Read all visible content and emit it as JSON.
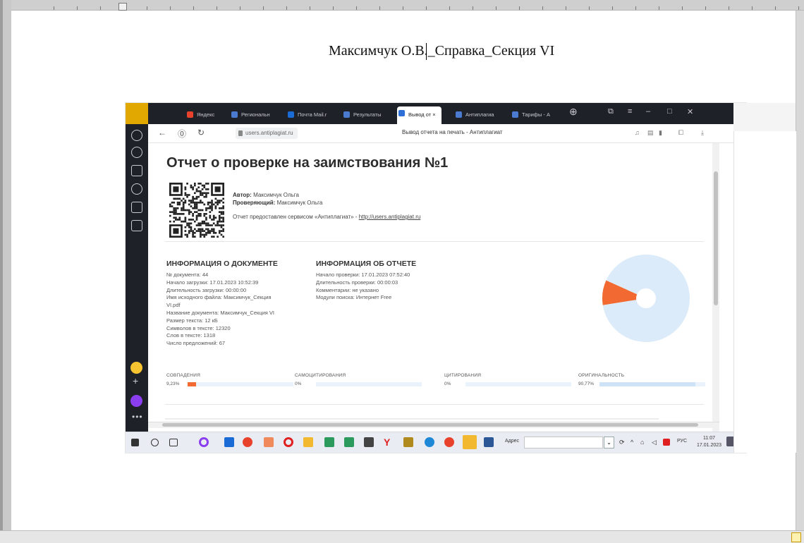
{
  "document": {
    "title": "Максимчук О.В._Справка_Секция VI"
  },
  "browser": {
    "tabs": [
      {
        "label": "Яндекс",
        "color": "#e8412c"
      },
      {
        "label": "Региональн",
        "color": "#4a7bd0"
      },
      {
        "label": "Почта Mail.r",
        "color": "#1b6bd6"
      },
      {
        "label": "Результаты",
        "color": "#4a7bd0"
      },
      {
        "label": "Вывод от",
        "color": "#2d6fd6"
      },
      {
        "label": "Антиплагиа",
        "color": "#4a7bd0"
      },
      {
        "label": "Тарифы - А",
        "color": "#4a7bd0"
      }
    ],
    "active_tab_close": "×",
    "url": "users.antiplagiat.ru",
    "page_title": "Вывод отчета на печать - Антиплагиат"
  },
  "report": {
    "title": "Отчет о проверке на заимствования №1",
    "author_label": "Автор:",
    "author_value": "Максимчук Ольга",
    "checker_label": "Проверяющий:",
    "checker_value": "Максимчук Ольга",
    "provided_text": "Отчет предоставлен сервисом «Антиплагиат» -",
    "provided_link": "http://users.antiplagiat.ru",
    "doc_info": {
      "heading": "ИНФОРМАЦИЯ О ДОКУМЕНТЕ",
      "lines": [
        "№ документа: 44",
        "Начало загрузки: 17.01.2023 10:52:39",
        "Длительность загрузки: 00:00:00",
        "Имя исходного файла: Максимчук_Секция",
        "VI.pdf",
        "Название документа: Максимчук_Секция VI",
        "Размер текста: 12 кБ",
        "Символов в тексте: 12320",
        "Слов в тексте: 1318",
        "Число предложений: 67"
      ]
    },
    "report_info": {
      "heading": "ИНФОРМАЦИЯ ОБ ОТЧЕТЕ",
      "lines": [
        "Начало проверки: 17.01.2023 07:52:40",
        "Длительность проверки: 00:00:03",
        "Комментарии: не указано",
        "Модули поиска: Интернет Free"
      ]
    },
    "stats": [
      {
        "label": "СОВПАДЕНИЯ",
        "value": "9,23%",
        "fraction": 0.0923,
        "color": "#f26a32"
      },
      {
        "label": "САМОЦИТИРОВАНИЯ",
        "value": "0%",
        "fraction": 0,
        "color": "#f26a32"
      },
      {
        "label": "ЦИТИРОВАНИЯ",
        "value": "0%",
        "fraction": 0,
        "color": "#2e9e4f"
      },
      {
        "label": "ОРИГИНАЛЬНОСТЬ",
        "value": "90,77%",
        "fraction": 0.9077,
        "color": "#cfe3f7"
      }
    ],
    "donut": {
      "matches_fraction": 0.0923,
      "matches_color": "#f26a32",
      "original_color": "#dcebf9"
    }
  },
  "taskbar": {
    "address_label": "Адрес",
    "lang": "РУС",
    "time": "11:07",
    "date": "17.01.2023"
  }
}
